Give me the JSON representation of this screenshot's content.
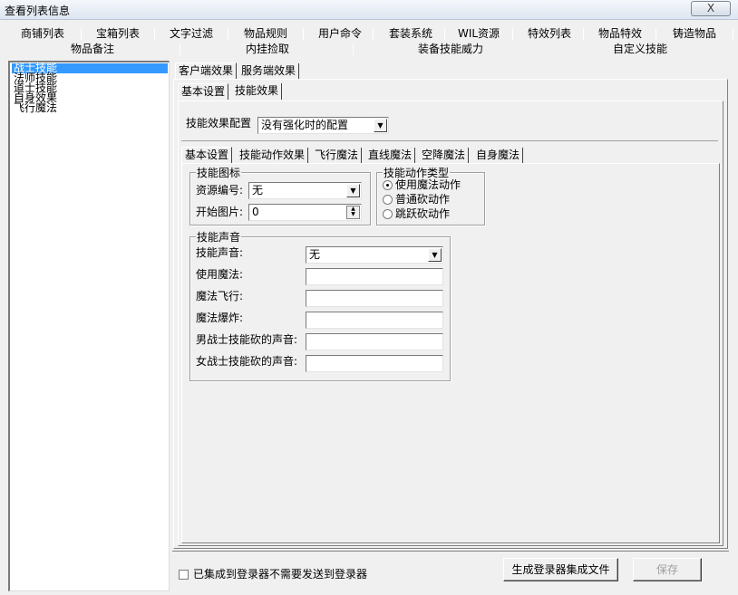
{
  "window": {
    "title": "查看列表信息",
    "close_label": "X"
  },
  "top_tabs_row1": [
    "商铺列表",
    "宝箱列表",
    "文字过滤",
    "物品规则",
    "用户命令",
    "套装系统",
    "WIL资源",
    "特效列表",
    "物品特效",
    "铸造物品"
  ],
  "top_tabs_row2": [
    "物品备注",
    "内挂捡取",
    "装备技能威力",
    "自定义技能"
  ],
  "skill_list": [
    "战士技能",
    "法师技能",
    "道士技能",
    "自身效果",
    "飞行魔法"
  ],
  "client_tabs": [
    "客户端效果",
    "服务端效果"
  ],
  "setting_tabs": [
    "基本设置",
    "技能效果"
  ],
  "effect_config": {
    "label": "技能效果配置",
    "value": "没有强化时的配置"
  },
  "effect_tabs": [
    "基本设置",
    "技能动作效果",
    "飞行魔法",
    "直线魔法",
    "空降魔法",
    "自身魔法"
  ],
  "icon_group": {
    "title": "技能图标",
    "resource_label": "资源编号:",
    "resource_value": "无",
    "start_label": "开始图片:",
    "start_value": "0"
  },
  "action_group": {
    "title": "技能动作类型",
    "options": [
      "使用魔法动作",
      "普通砍动作",
      "跳跃砍动作"
    ],
    "selected": "使用魔法动作"
  },
  "sound_group": {
    "title": "技能声音",
    "sound_label": "技能声音:",
    "sound_value": "无",
    "use_label": "使用魔法:",
    "fly_label": "魔法飞行:",
    "explode_label": "魔法爆炸:",
    "male_label": "男战士技能砍的声音:",
    "female_label": "女战士技能砍的声音:"
  },
  "footer": {
    "checkbox_label": "已集成到登录器不需要发送到登录器",
    "generate_button": "生成登录器集成文件",
    "save_button": "保存"
  }
}
